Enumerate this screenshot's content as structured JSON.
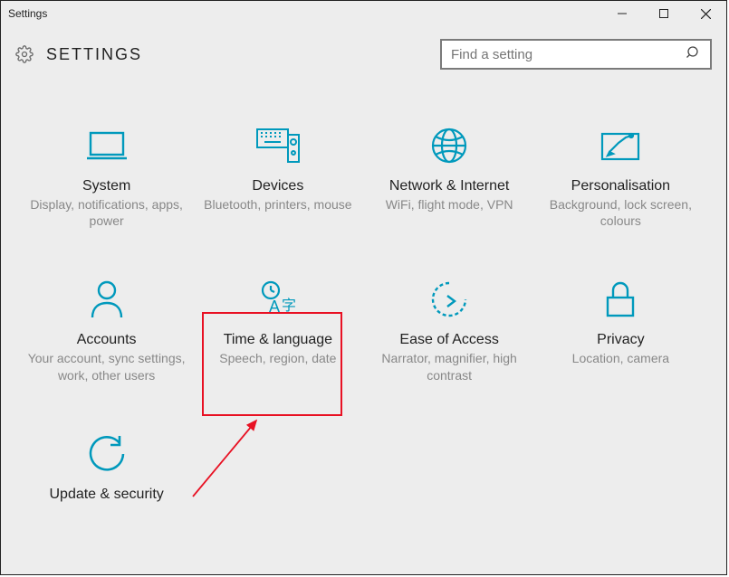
{
  "window": {
    "title": "Settings"
  },
  "header": {
    "title": "SETTINGS"
  },
  "search": {
    "placeholder": "Find a setting"
  },
  "tiles": [
    {
      "id": "system",
      "title": "System",
      "desc": "Display, notifications, apps, power"
    },
    {
      "id": "devices",
      "title": "Devices",
      "desc": "Bluetooth, printers, mouse"
    },
    {
      "id": "network",
      "title": "Network & Internet",
      "desc": "WiFi, flight mode, VPN"
    },
    {
      "id": "personalisation",
      "title": "Personalisation",
      "desc": "Background, lock screen, colours"
    },
    {
      "id": "accounts",
      "title": "Accounts",
      "desc": "Your account, sync settings, work, other users"
    },
    {
      "id": "time-language",
      "title": "Time & language",
      "desc": "Speech, region, date"
    },
    {
      "id": "ease-of-access",
      "title": "Ease of Access",
      "desc": "Narrator, magnifier, high contrast"
    },
    {
      "id": "privacy",
      "title": "Privacy",
      "desc": "Location, camera"
    },
    {
      "id": "update-security",
      "title": "Update & security",
      "desc": ""
    }
  ],
  "annotation": {
    "highlighted_tile": "time-language",
    "highlight_color": "#e81123",
    "arrow_color": "#e81123"
  }
}
